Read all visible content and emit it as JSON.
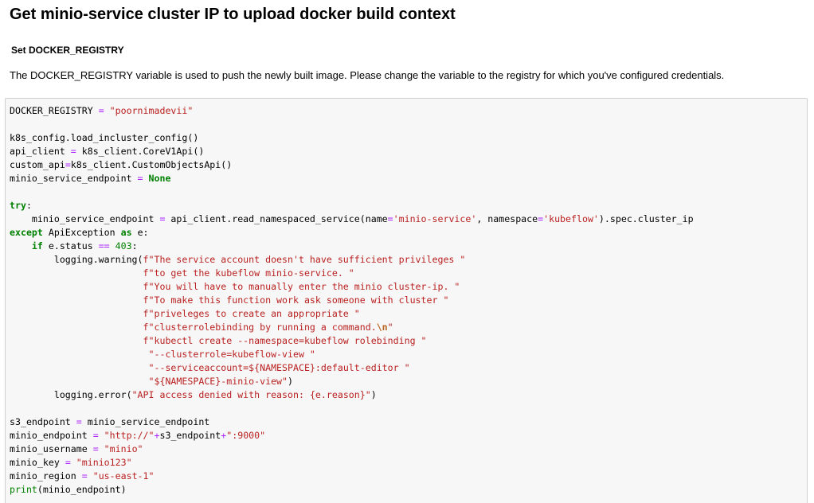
{
  "header": {
    "title": "Get minio-service cluster IP to upload docker build context"
  },
  "section": {
    "subtitle": "Set DOCKER_REGISTRY",
    "description": "The DOCKER_REGISTRY variable is used to push the newly built image. Please change the variable to the registry for which you've configured credentials."
  },
  "code": {
    "lines": [
      [
        {
          "t": "DOCKER_REGISTRY "
        },
        {
          "t": "=",
          "c": "op"
        },
        {
          "t": " "
        },
        {
          "t": "\"poornimadevii\"",
          "c": "str"
        }
      ],
      [
        {
          "t": ""
        }
      ],
      [
        {
          "t": "k8s_config.load_incluster_config()"
        }
      ],
      [
        {
          "t": "api_client "
        },
        {
          "t": "=",
          "c": "op"
        },
        {
          "t": " k8s_client.CoreV1Api()"
        }
      ],
      [
        {
          "t": "custom_api"
        },
        {
          "t": "=",
          "c": "op"
        },
        {
          "t": "k8s_client.CustomObjectsApi()"
        }
      ],
      [
        {
          "t": "minio_service_endpoint "
        },
        {
          "t": "=",
          "c": "op"
        },
        {
          "t": " "
        },
        {
          "t": "None",
          "c": "kw"
        }
      ],
      [
        {
          "t": ""
        }
      ],
      [
        {
          "t": "try",
          "c": "kw"
        },
        {
          "t": ":"
        }
      ],
      [
        {
          "t": "    minio_service_endpoint "
        },
        {
          "t": "=",
          "c": "op"
        },
        {
          "t": " api_client.read_namespaced_service(name"
        },
        {
          "t": "=",
          "c": "op"
        },
        {
          "t": "'minio-service'",
          "c": "str"
        },
        {
          "t": ", namespace"
        },
        {
          "t": "=",
          "c": "op"
        },
        {
          "t": "'kubeflow'",
          "c": "str"
        },
        {
          "t": ").spec.cluster_ip"
        }
      ],
      [
        {
          "t": "except",
          "c": "kw"
        },
        {
          "t": " ApiException "
        },
        {
          "t": "as",
          "c": "kw"
        },
        {
          "t": " e:"
        }
      ],
      [
        {
          "t": "    "
        },
        {
          "t": "if",
          "c": "kw"
        },
        {
          "t": " e.status "
        },
        {
          "t": "==",
          "c": "op"
        },
        {
          "t": " "
        },
        {
          "t": "403",
          "c": "num"
        },
        {
          "t": ":"
        }
      ],
      [
        {
          "t": "        logging.warning("
        },
        {
          "t": "f\"The service account doesn't have sufficient privileges \"",
          "c": "str"
        }
      ],
      [
        {
          "t": "                        "
        },
        {
          "t": "f\"to get the kubeflow minio-service. \"",
          "c": "str"
        }
      ],
      [
        {
          "t": "                        "
        },
        {
          "t": "f\"You will have to manually enter the minio cluster-ip. \"",
          "c": "str"
        }
      ],
      [
        {
          "t": "                        "
        },
        {
          "t": "f\"To make this function work ask someone with cluster \"",
          "c": "str"
        }
      ],
      [
        {
          "t": "                        "
        },
        {
          "t": "f\"priveleges to create an appropriate \"",
          "c": "str"
        }
      ],
      [
        {
          "t": "                        "
        },
        {
          "t": "f\"clusterrolebinding by running a command.",
          "c": "str"
        },
        {
          "t": "\\n",
          "c": "esc"
        },
        {
          "t": "\"",
          "c": "str"
        }
      ],
      [
        {
          "t": "                        "
        },
        {
          "t": "f\"kubectl create --namespace=kubeflow rolebinding \"",
          "c": "str"
        }
      ],
      [
        {
          "t": "                         "
        },
        {
          "t": "\"--clusterrole=kubeflow-view \"",
          "c": "str"
        }
      ],
      [
        {
          "t": "                         "
        },
        {
          "t": "\"--serviceaccount=${NAMESPACE}:default-editor \"",
          "c": "str"
        }
      ],
      [
        {
          "t": "                         "
        },
        {
          "t": "\"${NAMESPACE}-minio-view\"",
          "c": "str"
        },
        {
          "t": ")"
        }
      ],
      [
        {
          "t": "        logging.error("
        },
        {
          "t": "\"API access denied with reason: ",
          "c": "str"
        },
        {
          "t": "{e.reason}",
          "c": "str"
        },
        {
          "t": "\"",
          "c": "str"
        },
        {
          "t": ")"
        }
      ],
      [
        {
          "t": ""
        }
      ],
      [
        {
          "t": "s3_endpoint "
        },
        {
          "t": "=",
          "c": "op"
        },
        {
          "t": " minio_service_endpoint"
        }
      ],
      [
        {
          "t": "minio_endpoint "
        },
        {
          "t": "=",
          "c": "op"
        },
        {
          "t": " "
        },
        {
          "t": "\"http://\"",
          "c": "str"
        },
        {
          "t": "+",
          "c": "op"
        },
        {
          "t": "s3_endpoint"
        },
        {
          "t": "+",
          "c": "op"
        },
        {
          "t": "\":9000\"",
          "c": "str"
        }
      ],
      [
        {
          "t": "minio_username "
        },
        {
          "t": "=",
          "c": "op"
        },
        {
          "t": " "
        },
        {
          "t": "\"minio\"",
          "c": "str"
        }
      ],
      [
        {
          "t": "minio_key "
        },
        {
          "t": "=",
          "c": "op"
        },
        {
          "t": " "
        },
        {
          "t": "\"minio123\"",
          "c": "str"
        }
      ],
      [
        {
          "t": "minio_region "
        },
        {
          "t": "=",
          "c": "op"
        },
        {
          "t": " "
        },
        {
          "t": "\"us-east-1\"",
          "c": "str"
        }
      ],
      [
        {
          "t": "print",
          "c": "bi"
        },
        {
          "t": "(minio_endpoint)"
        }
      ]
    ]
  }
}
